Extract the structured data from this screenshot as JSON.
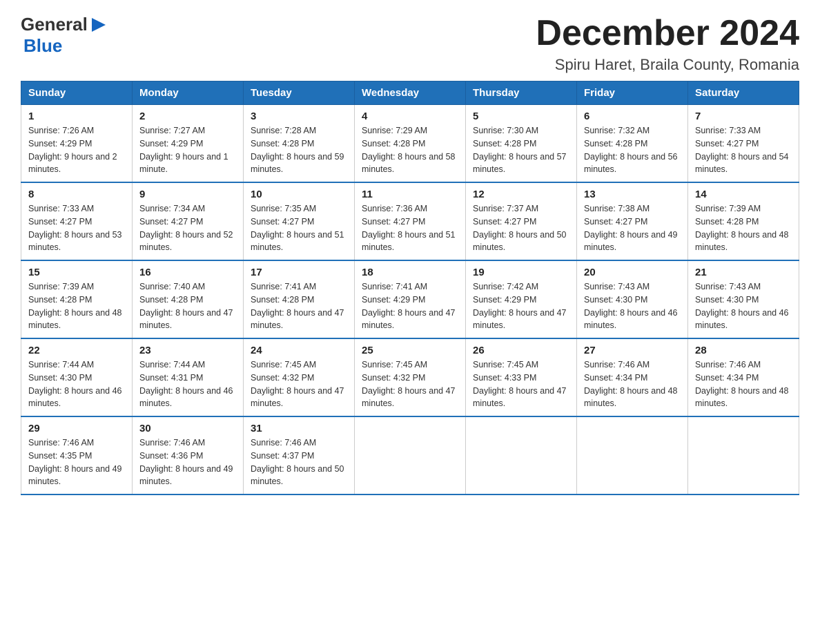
{
  "logo": {
    "text_general": "General",
    "text_blue": "Blue",
    "arrow_color": "#1565c0"
  },
  "title": "December 2024",
  "subtitle": "Spiru Haret, Braila County, Romania",
  "days_header": [
    "Sunday",
    "Monday",
    "Tuesday",
    "Wednesday",
    "Thursday",
    "Friday",
    "Saturday"
  ],
  "weeks": [
    [
      {
        "day": "1",
        "sunrise": "7:26 AM",
        "sunset": "4:29 PM",
        "daylight": "9 hours and 2 minutes."
      },
      {
        "day": "2",
        "sunrise": "7:27 AM",
        "sunset": "4:29 PM",
        "daylight": "9 hours and 1 minute."
      },
      {
        "day": "3",
        "sunrise": "7:28 AM",
        "sunset": "4:28 PM",
        "daylight": "8 hours and 59 minutes."
      },
      {
        "day": "4",
        "sunrise": "7:29 AM",
        "sunset": "4:28 PM",
        "daylight": "8 hours and 58 minutes."
      },
      {
        "day": "5",
        "sunrise": "7:30 AM",
        "sunset": "4:28 PM",
        "daylight": "8 hours and 57 minutes."
      },
      {
        "day": "6",
        "sunrise": "7:32 AM",
        "sunset": "4:28 PM",
        "daylight": "8 hours and 56 minutes."
      },
      {
        "day": "7",
        "sunrise": "7:33 AM",
        "sunset": "4:27 PM",
        "daylight": "8 hours and 54 minutes."
      }
    ],
    [
      {
        "day": "8",
        "sunrise": "7:33 AM",
        "sunset": "4:27 PM",
        "daylight": "8 hours and 53 minutes."
      },
      {
        "day": "9",
        "sunrise": "7:34 AM",
        "sunset": "4:27 PM",
        "daylight": "8 hours and 52 minutes."
      },
      {
        "day": "10",
        "sunrise": "7:35 AM",
        "sunset": "4:27 PM",
        "daylight": "8 hours and 51 minutes."
      },
      {
        "day": "11",
        "sunrise": "7:36 AM",
        "sunset": "4:27 PM",
        "daylight": "8 hours and 51 minutes."
      },
      {
        "day": "12",
        "sunrise": "7:37 AM",
        "sunset": "4:27 PM",
        "daylight": "8 hours and 50 minutes."
      },
      {
        "day": "13",
        "sunrise": "7:38 AM",
        "sunset": "4:27 PM",
        "daylight": "8 hours and 49 minutes."
      },
      {
        "day": "14",
        "sunrise": "7:39 AM",
        "sunset": "4:28 PM",
        "daylight": "8 hours and 48 minutes."
      }
    ],
    [
      {
        "day": "15",
        "sunrise": "7:39 AM",
        "sunset": "4:28 PM",
        "daylight": "8 hours and 48 minutes."
      },
      {
        "day": "16",
        "sunrise": "7:40 AM",
        "sunset": "4:28 PM",
        "daylight": "8 hours and 47 minutes."
      },
      {
        "day": "17",
        "sunrise": "7:41 AM",
        "sunset": "4:28 PM",
        "daylight": "8 hours and 47 minutes."
      },
      {
        "day": "18",
        "sunrise": "7:41 AM",
        "sunset": "4:29 PM",
        "daylight": "8 hours and 47 minutes."
      },
      {
        "day": "19",
        "sunrise": "7:42 AM",
        "sunset": "4:29 PM",
        "daylight": "8 hours and 47 minutes."
      },
      {
        "day": "20",
        "sunrise": "7:43 AM",
        "sunset": "4:30 PM",
        "daylight": "8 hours and 46 minutes."
      },
      {
        "day": "21",
        "sunrise": "7:43 AM",
        "sunset": "4:30 PM",
        "daylight": "8 hours and 46 minutes."
      }
    ],
    [
      {
        "day": "22",
        "sunrise": "7:44 AM",
        "sunset": "4:30 PM",
        "daylight": "8 hours and 46 minutes."
      },
      {
        "day": "23",
        "sunrise": "7:44 AM",
        "sunset": "4:31 PM",
        "daylight": "8 hours and 46 minutes."
      },
      {
        "day": "24",
        "sunrise": "7:45 AM",
        "sunset": "4:32 PM",
        "daylight": "8 hours and 47 minutes."
      },
      {
        "day": "25",
        "sunrise": "7:45 AM",
        "sunset": "4:32 PM",
        "daylight": "8 hours and 47 minutes."
      },
      {
        "day": "26",
        "sunrise": "7:45 AM",
        "sunset": "4:33 PM",
        "daylight": "8 hours and 47 minutes."
      },
      {
        "day": "27",
        "sunrise": "7:46 AM",
        "sunset": "4:34 PM",
        "daylight": "8 hours and 48 minutes."
      },
      {
        "day": "28",
        "sunrise": "7:46 AM",
        "sunset": "4:34 PM",
        "daylight": "8 hours and 48 minutes."
      }
    ],
    [
      {
        "day": "29",
        "sunrise": "7:46 AM",
        "sunset": "4:35 PM",
        "daylight": "8 hours and 49 minutes."
      },
      {
        "day": "30",
        "sunrise": "7:46 AM",
        "sunset": "4:36 PM",
        "daylight": "8 hours and 49 minutes."
      },
      {
        "day": "31",
        "sunrise": "7:46 AM",
        "sunset": "4:37 PM",
        "daylight": "8 hours and 50 minutes."
      },
      null,
      null,
      null,
      null
    ]
  ]
}
